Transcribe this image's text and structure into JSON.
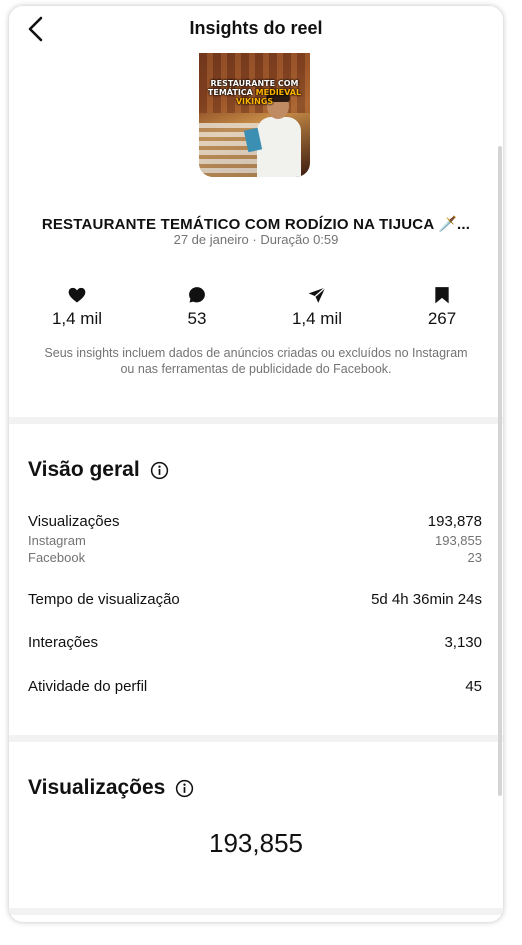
{
  "header": {
    "title": "Insights do reel"
  },
  "thumbnail": {
    "caption_line1": "RESTAURANTE COM",
    "caption_line2a": "TEMÁTICA ",
    "caption_line2b": "MEDIEVAL VIKINGS"
  },
  "reel": {
    "title": "RESTAURANTE TEMÁTICO COM RODÍZIO NA TIJUCA 🗡️...",
    "subtitle": "27 de janeiro · Duração 0:59"
  },
  "stats": [
    {
      "icon": "heart-icon",
      "value": "1,4 mil"
    },
    {
      "icon": "comment-icon",
      "value": "53"
    },
    {
      "icon": "send-icon",
      "value": "1,4 mil"
    },
    {
      "icon": "bookmark-icon",
      "value": "267"
    }
  ],
  "disclaimer": "Seus insights incluem dados de anúncios criadas ou excluídos no Instagram ou nas ferramentas de publicidade do Facebook.",
  "overview": {
    "title": "Visão geral",
    "rows": [
      {
        "label": "Visualizações",
        "value": "193,878"
      },
      {
        "label": "Instagram",
        "value": "193,855"
      },
      {
        "label": "Facebook",
        "value": "23"
      },
      {
        "label": "Tempo de visualização",
        "value": "5d 4h 36min 24s"
      },
      {
        "label": "Interações",
        "value": "3,130"
      },
      {
        "label": "Atividade do perfil",
        "value": "45"
      }
    ]
  },
  "views": {
    "title": "Visualizações",
    "total": "193,855"
  },
  "colors": {
    "text": "#111111",
    "muted": "#737373",
    "divider": "#f2f2f2"
  }
}
